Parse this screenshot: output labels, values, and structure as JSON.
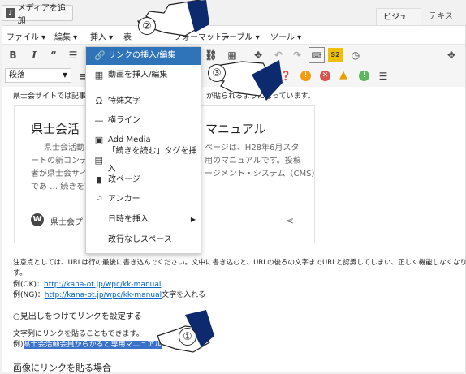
{
  "top": {
    "media_button": "メディアを追加",
    "tab_visual": "ビジュアル",
    "tab_text": "テキスト"
  },
  "menubar": [
    {
      "label": "ファイル ▾"
    },
    {
      "label": "編集 ▾"
    },
    {
      "label": "挿入 ▾"
    },
    {
      "label": "表"
    },
    {
      "label": "フォーマット ▾"
    },
    {
      "label": "テーブル ▾"
    },
    {
      "label": "ツール ▾"
    }
  ],
  "format_select": "段落",
  "dropdown": {
    "items": [
      {
        "label": "リンクの挿入/編集",
        "icon": "link-icon",
        "glyph": "🔗"
      },
      {
        "label": "動画を挿入/編集",
        "icon": "video-icon",
        "glyph": "▦"
      },
      {
        "label": "特殊文字",
        "icon": "omega-icon",
        "glyph": "Ω"
      },
      {
        "label": "横ライン",
        "icon": "horizontal-line-icon",
        "glyph": "—"
      },
      {
        "label": "Add Media",
        "icon": "media-icon",
        "glyph": "▣"
      },
      {
        "label": "「続きを読む」タグを挿入",
        "icon": "more-tag-icon",
        "glyph": "▤"
      },
      {
        "label": "改ページ",
        "icon": "page-break-icon",
        "glyph": "▮"
      },
      {
        "label": "アンカー",
        "icon": "anchor-icon",
        "glyph": "⚐"
      },
      {
        "label": "日時を挿入",
        "icon": "datetime-icon",
        "glyph": ""
      },
      {
        "label": "改行なしスペース",
        "icon": "nbsp-icon",
        "glyph": ""
      }
    ]
  },
  "content": {
    "intro": "県士会サイトでは記事を",
    "intro_tail": "が貼られるようになっています。",
    "card_title": "県士会活",
    "card_title2": "マニュアル",
    "excerpt_1": "県士会活動",
    "excerpt_1b": "ページは、H28年6月スタ",
    "excerpt_2": "ートの新コンテン",
    "excerpt_2b": "用のマニュアルです。投稿",
    "excerpt_3": "者が県士会サイ",
    "excerpt_3b": "ージメント・システム（CMS）",
    "excerpt_4": "であ … 続きを読",
    "card_site": "県士会プ",
    "note_1": "注意点としては、URLは行の最後に書き込んでください。文中に書き込むと、URLの後ろの文字までURLと認識してしまい、正しく機能しなくなりま",
    "note_2": "す。",
    "ok_prefix": "例(OK)：",
    "ok_url": "http://kana-ot.jp/wpc/kk-manual",
    "ng_prefix": "例(NG)：",
    "ng_url": "http://kana-ot.jp/wpc/kk-manual",
    "ng_suffix": "文字を入れる",
    "heading_link": "○見出しをつけてリンクを設定する",
    "text_link": "文字列にリンクを貼ることもできます。",
    "example_prefix": "例)",
    "example_selected": "県士会活動会員からかると専用マニュアル",
    "bottom_heading": "画像にリンクを貼る場合"
  },
  "callouts": [
    "②",
    "③",
    "①"
  ]
}
